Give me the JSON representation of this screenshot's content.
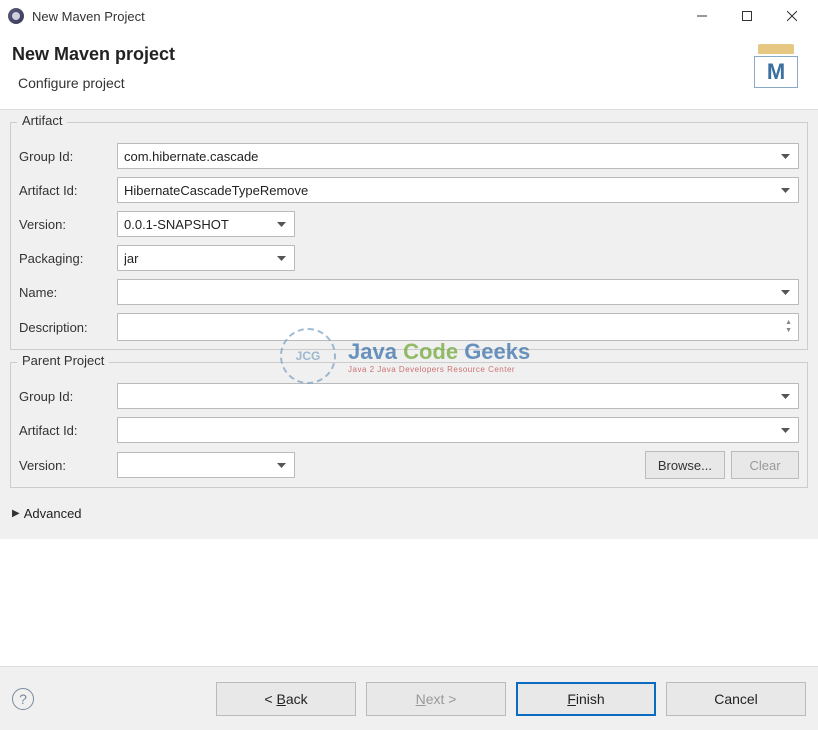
{
  "window": {
    "title": "New Maven Project"
  },
  "header": {
    "heading": "New Maven project",
    "subheading": "Configure project",
    "wizard_icon_letter": "M"
  },
  "artifact": {
    "legend": "Artifact",
    "labels": {
      "group_id": "Group Id:",
      "artifact_id": "Artifact Id:",
      "version": "Version:",
      "packaging": "Packaging:",
      "name": "Name:",
      "description": "Description:"
    },
    "values": {
      "group_id": "com.hibernate.cascade",
      "artifact_id": "HibernateCascadeTypeRemove",
      "version": "0.0.1-SNAPSHOT",
      "packaging": "jar",
      "name": "",
      "description": ""
    }
  },
  "parent": {
    "legend": "Parent Project",
    "labels": {
      "group_id": "Group Id:",
      "artifact_id": "Artifact Id:",
      "version": "Version:"
    },
    "values": {
      "group_id": "",
      "artifact_id": "",
      "version": ""
    },
    "buttons": {
      "browse": "Browse...",
      "clear": "Clear"
    }
  },
  "advanced": {
    "label": "Advanced"
  },
  "footer": {
    "back": "< Back",
    "next": "Next >",
    "finish": "Finish",
    "cancel": "Cancel",
    "help": "?"
  },
  "watermark": {
    "logo_text": "JCG",
    "line1_java": "Java ",
    "line1_code": "Code ",
    "line1_geeks": "Geeks",
    "line2": "Java 2 Java Developers Resource Center"
  }
}
